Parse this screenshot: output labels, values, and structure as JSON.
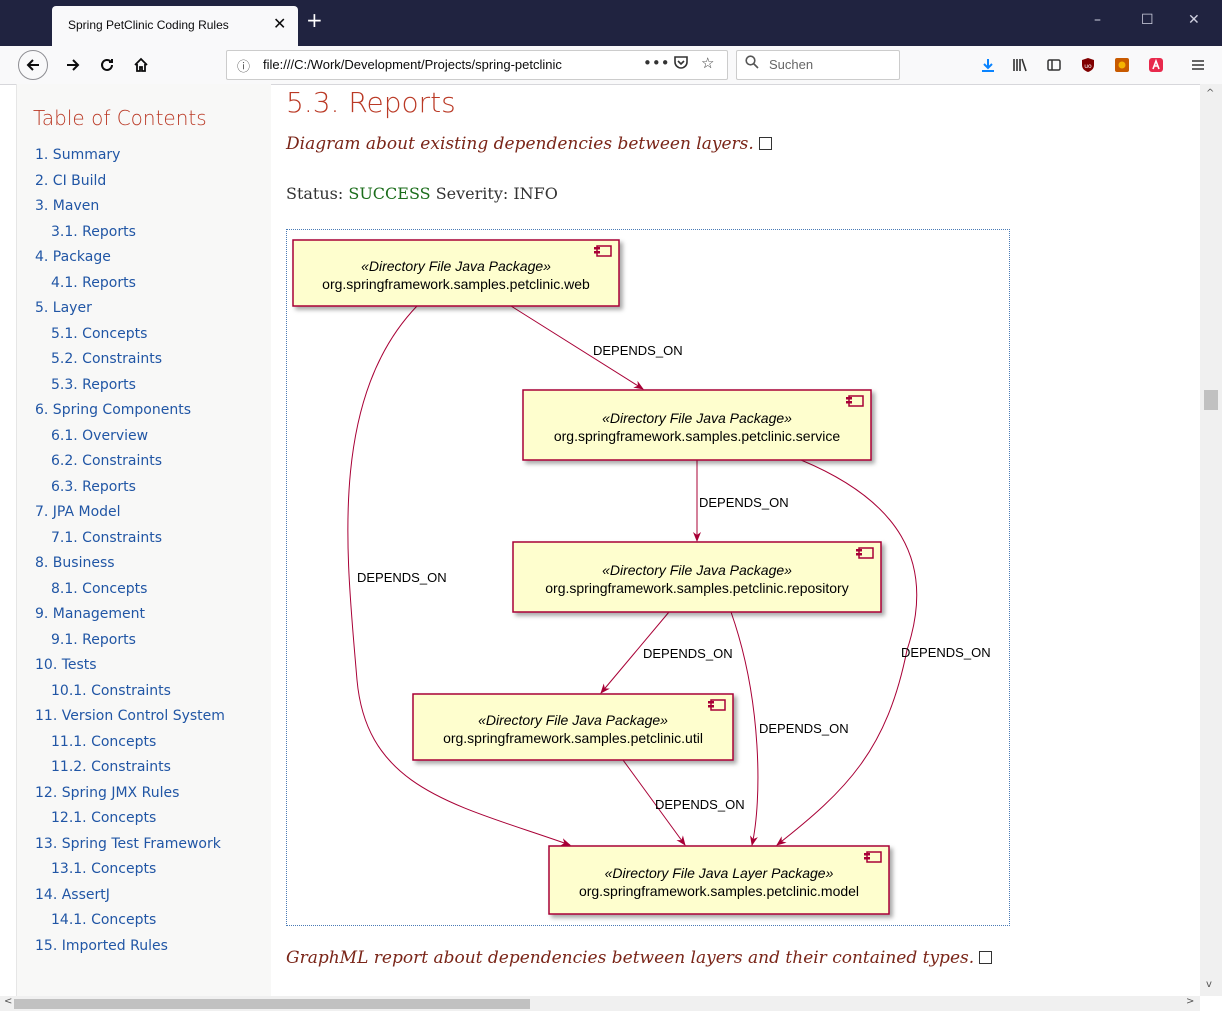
{
  "browser": {
    "tab_title": "Spring PetClinic Coding Rules",
    "tab_close": "✕",
    "new_tab": "+",
    "url": "file:///C:/Work/Development/Projects/spring-petclinic",
    "url_more": "•••",
    "search_placeholder": "Suchen",
    "window_controls": {
      "minimize": "–",
      "maximize": "☐",
      "close": "✕"
    },
    "icons": [
      "back-icon",
      "forward-icon",
      "reload-icon",
      "home-icon",
      "info-icon",
      "pocket-icon",
      "bookmark-star-icon",
      "search-icon",
      "download-icon",
      "library-icon",
      "sidebar-icon",
      "ublock-icon",
      "extension-icon",
      "adblock-icon",
      "menu-icon"
    ],
    "accent_color": "#0a84ff"
  },
  "toc": {
    "title": "Table of Contents",
    "items": [
      {
        "label": "1. Summary",
        "level": 1
      },
      {
        "label": "2. CI Build",
        "level": 1
      },
      {
        "label": "3. Maven",
        "level": 1
      },
      {
        "label": "3.1. Reports",
        "level": 2
      },
      {
        "label": "4. Package",
        "level": 1
      },
      {
        "label": "4.1. Reports",
        "level": 2
      },
      {
        "label": "5. Layer",
        "level": 1
      },
      {
        "label": "5.1. Concepts",
        "level": 2
      },
      {
        "label": "5.2. Constraints",
        "level": 2
      },
      {
        "label": "5.3. Reports",
        "level": 2
      },
      {
        "label": "6. Spring Components",
        "level": 1
      },
      {
        "label": "6.1. Overview",
        "level": 2
      },
      {
        "label": "6.2. Constraints",
        "level": 2
      },
      {
        "label": "6.3. Reports",
        "level": 2
      },
      {
        "label": "7. JPA Model",
        "level": 1
      },
      {
        "label": "7.1. Constraints",
        "level": 2
      },
      {
        "label": "8. Business",
        "level": 1
      },
      {
        "label": "8.1. Concepts",
        "level": 2
      },
      {
        "label": "9. Management",
        "level": 1
      },
      {
        "label": "9.1. Reports",
        "level": 2
      },
      {
        "label": "10. Tests",
        "level": 1
      },
      {
        "label": "10.1. Constraints",
        "level": 2
      },
      {
        "label": "11. Version Control System",
        "level": 1
      },
      {
        "label": "11.1. Concepts",
        "level": 2
      },
      {
        "label": "11.2. Constraints",
        "level": 2
      },
      {
        "label": "12. Spring JMX Rules",
        "level": 1
      },
      {
        "label": "12.1. Concepts",
        "level": 2
      },
      {
        "label": "13. Spring Test Framework",
        "level": 1
      },
      {
        "label": "13.1. Concepts",
        "level": 2
      },
      {
        "label": "14. AssertJ",
        "level": 1
      },
      {
        "label": "14.1. Concepts",
        "level": 2
      },
      {
        "label": "15. Imported Rules",
        "level": 1
      }
    ]
  },
  "content": {
    "heading": "5.3. Reports",
    "caption1": "Diagram about existing dependencies between layers.",
    "status_label": "Status:",
    "status_value": "SUCCESS",
    "severity_label": "Severity:",
    "severity_value": "INFO",
    "caption2": "GraphML report about dependencies between layers and their contained types."
  },
  "diagram": {
    "node_fill": "#fefece",
    "node_border": "#a80036",
    "edge_color": "#a80036",
    "nodes": [
      {
        "id": "web",
        "stereotype": "«Directory File Java Package»",
        "name": "org.springframework.samples.petclinic.web"
      },
      {
        "id": "service",
        "stereotype": "«Directory File Java Package»",
        "name": "org.springframework.samples.petclinic.service"
      },
      {
        "id": "repository",
        "stereotype": "«Directory File Java Package»",
        "name": "org.springframework.samples.petclinic.repository"
      },
      {
        "id": "util",
        "stereotype": "«Directory File Java Package»",
        "name": "org.springframework.samples.petclinic.util"
      },
      {
        "id": "model",
        "stereotype": "«Directory File Java Layer Package»",
        "name": "org.springframework.samples.petclinic.model"
      }
    ],
    "edges": [
      {
        "from": "web",
        "to": "service",
        "label": "DEPENDS_ON"
      },
      {
        "from": "web",
        "to": "model",
        "label": "DEPENDS_ON"
      },
      {
        "from": "service",
        "to": "repository",
        "label": "DEPENDS_ON"
      },
      {
        "from": "service",
        "to": "model",
        "label": "DEPENDS_ON"
      },
      {
        "from": "repository",
        "to": "util",
        "label": "DEPENDS_ON"
      },
      {
        "from": "repository",
        "to": "model",
        "label": "DEPENDS_ON"
      },
      {
        "from": "util",
        "to": "model",
        "label": "DEPENDS_ON"
      }
    ]
  }
}
